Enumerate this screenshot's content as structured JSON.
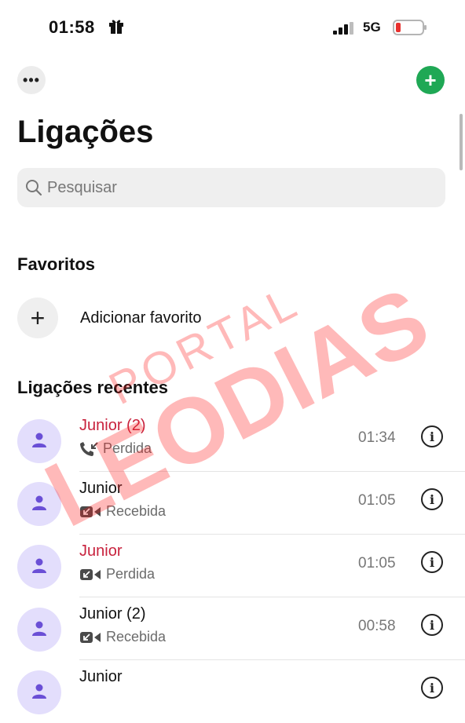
{
  "status_bar": {
    "time": "01:58",
    "network": "5G"
  },
  "colors": {
    "accent_green": "#1fa855",
    "missed_red": "#c8233e",
    "avatar_bg": "#e3defc",
    "avatar_fg": "#6a4fd6",
    "watermark": "#ff1b1b"
  },
  "header": {
    "more_label": "•••",
    "add_label": "+",
    "title": "Ligações"
  },
  "search": {
    "placeholder": "Pesquisar"
  },
  "favorites": {
    "heading": "Favoritos",
    "add_label": "Adicionar favorito"
  },
  "recents": {
    "heading": "Ligações recentes",
    "calls": [
      {
        "name": "Junior  (2)",
        "type": "Perdida",
        "icon": "phone-missed-icon",
        "time": "01:34",
        "missed": true
      },
      {
        "name": "Junior",
        "type": "Recebida",
        "icon": "video-incoming-icon",
        "time": "01:05",
        "missed": false
      },
      {
        "name": "Junior",
        "type": "Perdida",
        "icon": "video-incoming-icon",
        "time": "01:05",
        "missed": true
      },
      {
        "name": "Junior  (2)",
        "type": "Recebida",
        "icon": "video-incoming-icon",
        "time": "00:58",
        "missed": false
      },
      {
        "name": "Junior",
        "type": "",
        "icon": "",
        "time": "",
        "missed": false
      }
    ]
  },
  "watermark": {
    "line1": "PORTAL",
    "line2": "LEODIAS"
  }
}
